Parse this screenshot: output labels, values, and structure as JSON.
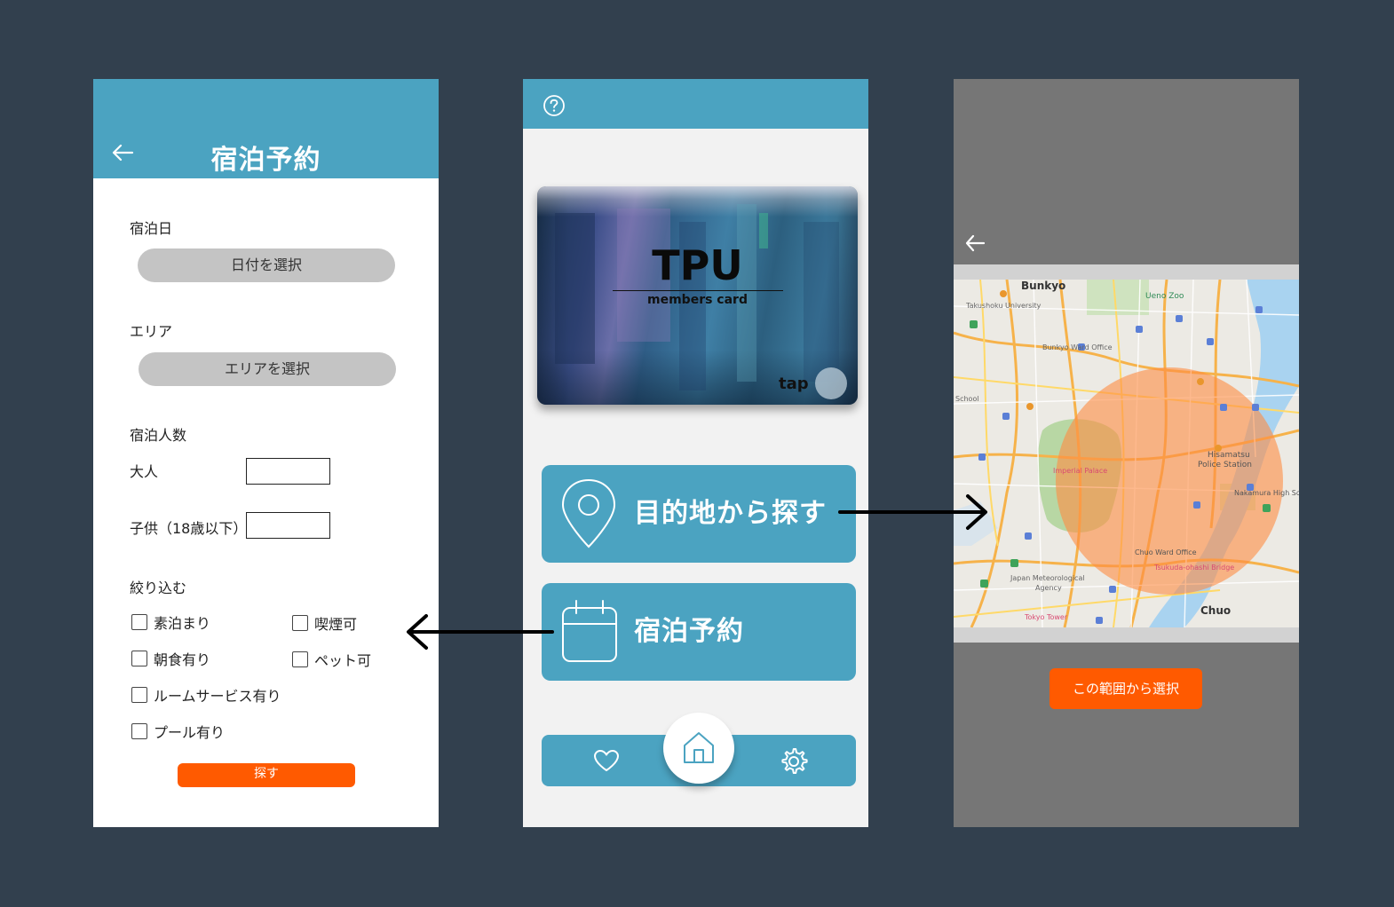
{
  "left_screen": {
    "title": "宿泊予約",
    "date_label": "宿泊日",
    "date_button": "日付を選択",
    "area_label": "エリア",
    "area_button": "エリアを選択",
    "guests_label": "宿泊人数",
    "adult_label": "大人",
    "adult_value": "",
    "child_label": "子供（18歳以下）",
    "child_value": "",
    "filter_label": "絞り込む",
    "filters": [
      {
        "label": "素泊まり",
        "checked": false
      },
      {
        "label": "喫煙可",
        "checked": false
      },
      {
        "label": "朝食有り",
        "checked": false
      },
      {
        "label": "ペット可",
        "checked": false
      },
      {
        "label": "ルームサービス有り",
        "checked": false
      },
      {
        "label": "プール有り",
        "checked": false
      }
    ],
    "search_button": "探す"
  },
  "middle_screen": {
    "card": {
      "title": "TPU",
      "subtitle": "members card",
      "tap_label": "tap"
    },
    "destination_button": "目的地から探す",
    "booking_button": "宿泊予約",
    "tabs": {
      "left_icon": "heart-icon",
      "center_icon": "home-icon",
      "right_icon": "gear-icon"
    }
  },
  "right_screen": {
    "map_labels": {
      "bunkyo": "Bunkyo",
      "ueno_zoo": "Ueno Zoo",
      "takushoku": "Takushoku University",
      "bunkyo_ward": "Bunkyo Ward Office",
      "school": "School",
      "imperial_palace": "Imperial Palace",
      "hisamatsu": "Hisamatsu",
      "police": "Police Station",
      "nakamura": "Nakamura High Sc",
      "chuo_ward": "Chuo Ward Office",
      "tsukuda": "Tsukuda-ohashi Bridge",
      "jma": "Japan Meteorological",
      "agency": "Agency",
      "tokyo_tower": "Tokyo Tower",
      "chuo": "Chuo"
    },
    "select_button": "この範囲から選択"
  },
  "colors": {
    "background": "#32404e",
    "header_blue": "#4ba3c1",
    "accent_orange": "#ff5a00",
    "map_circle": "#ff8c42"
  }
}
